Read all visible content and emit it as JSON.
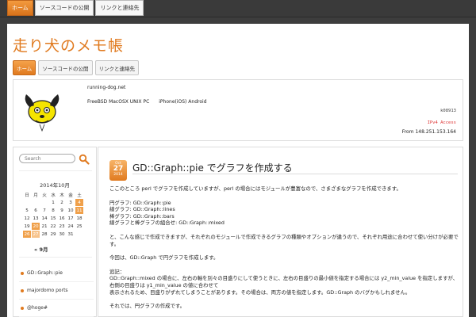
{
  "topnav": {
    "items": [
      "ホーム",
      "ソースコードの公開",
      "リンクと連絡先"
    ]
  },
  "site": {
    "title": "走り犬のメモ帳"
  },
  "subnav": {
    "items": [
      "ホーム",
      "ソースコードの公開",
      "リンクと連絡先"
    ]
  },
  "header": {
    "site_name": "running-dog.net",
    "tags": [
      "FreeBSD MacOSX UNIX PC",
      "iPhone(iOS) Android"
    ],
    "code": "k08913",
    "red_text": "IPv4 Access",
    "from": "From 148.251.153.164"
  },
  "sidebar": {
    "search_placeholder": "Search",
    "calendar": {
      "title": "2014年10月",
      "weekdays": [
        "日",
        "月",
        "火",
        "水",
        "木",
        "金",
        "土"
      ],
      "weeks": [
        [
          "",
          "",
          "",
          "1",
          "2",
          "3",
          "4"
        ],
        [
          "5",
          "6",
          "7",
          "8",
          "9",
          "10",
          "11"
        ],
        [
          "12",
          "13",
          "14",
          "15",
          "16",
          "17",
          "18"
        ],
        [
          "19",
          "20",
          "21",
          "22",
          "23",
          "24",
          "25"
        ],
        [
          "26",
          "27",
          "28",
          "29",
          "30",
          "31",
          ""
        ]
      ],
      "highlighted": [
        "4",
        "11",
        "20",
        "26"
      ],
      "today": "27",
      "prev": "« 9月"
    },
    "recent_posts": [
      "GD::Graph::pie",
      "majordomo ports",
      "@hoge#"
    ]
  },
  "post": {
    "date": {
      "month": "Oct",
      "day": "27",
      "year": "2014"
    },
    "title": "GD::Graph::pie でグラフを作成する",
    "paragraphs": [
      "ここのところ perl でグラフを作成していますが、perl の場合にはモジュールが豊富なので、さまざまなグラフを作成できます。",
      "円グラフ: GD::Graph::pie\n線グラフ: GD::Graph::lines\n棒グラフ: GD::Graph::bars\n線グラフと棒グラフの組合せ: GD::Graph::mixed",
      "と、こんな感じで作成できますが、それぞれのモジュールで作成できるグラフの種類やオプションが違うので、それぞれ用途に合わせて使い分けが必要です。",
      "今回は、GD::Graph で円グラフを作成します。",
      "追記：\nGD::Graph::mixed の場合に、左右の軸を別々の目盛りにして使うときに、左右の目盛りの最小値を指定する場合には y2_min_value を指定しますが、右側の目盛りは y1_min_value の値に合わせて\n表示されるため、目盛りがずれてしまうことがあります。その場合は、両方の値を指定します。GD::Graph のバグかもしれません。",
      "それでは、円グラフの作成です。"
    ]
  },
  "colors": {
    "accent": "#e07a1f",
    "background": "#3d3d3d"
  }
}
